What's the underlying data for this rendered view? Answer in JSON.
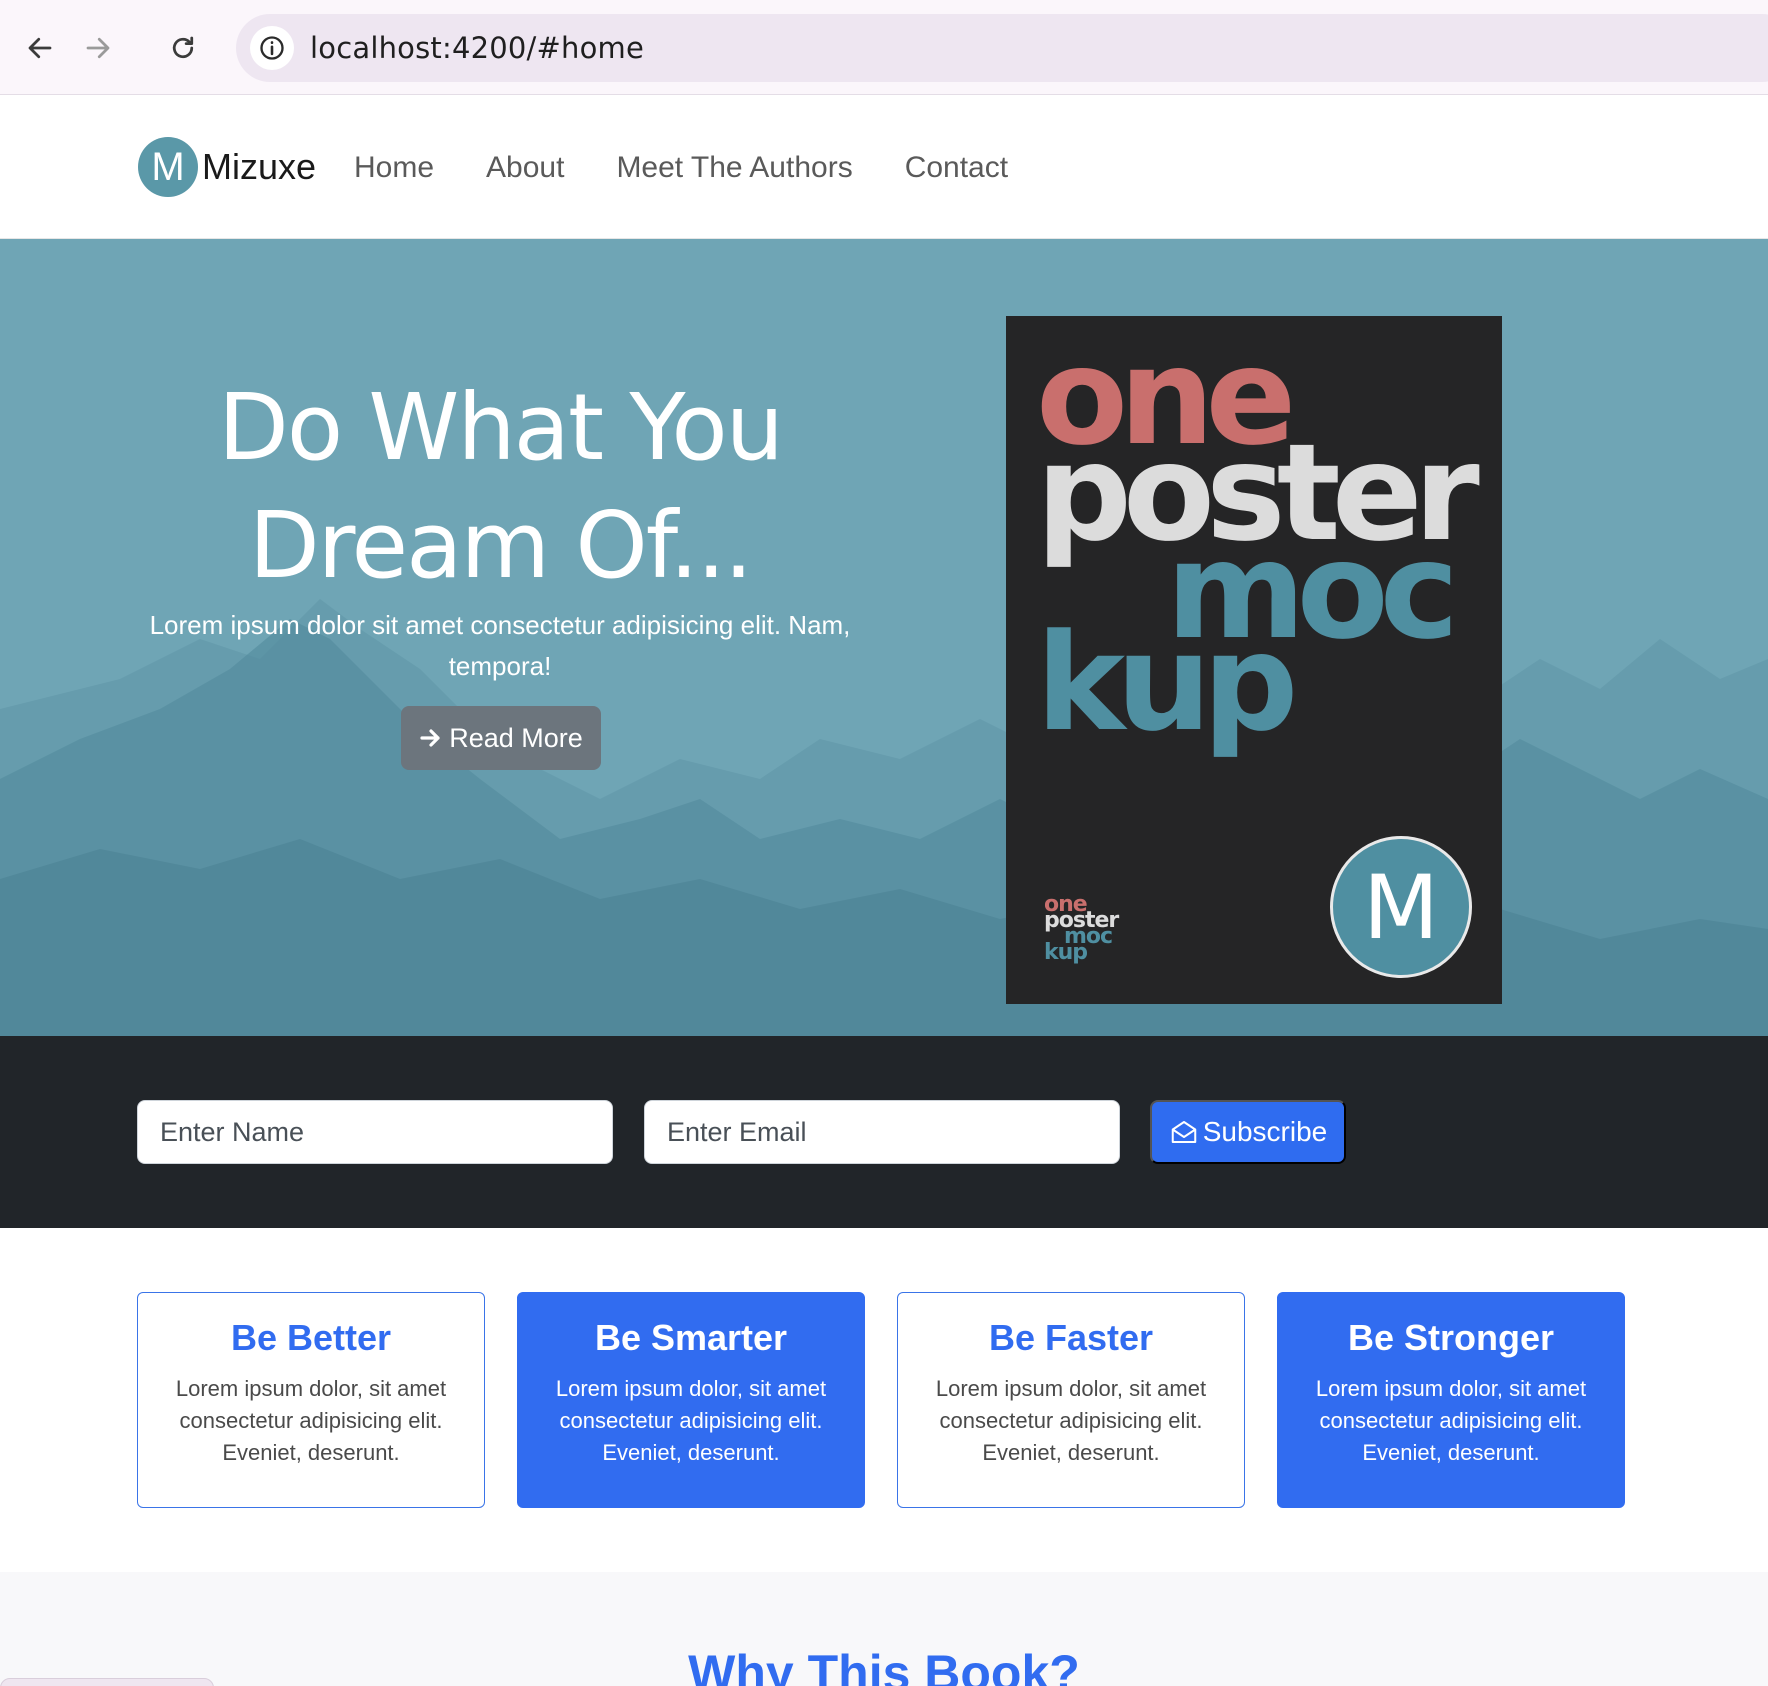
{
  "browser": {
    "url": "localhost:4200/#home",
    "icons": {
      "back": "arrow-left-icon",
      "forward": "arrow-right-icon",
      "reload": "reload-icon",
      "info": "info-icon"
    }
  },
  "navbar": {
    "brand_letter": "M",
    "brand_name": "Mizuxe",
    "links": [
      "Home",
      "About",
      "Meet The Authors",
      "Contact"
    ]
  },
  "hero": {
    "title_line1": "Do What You",
    "title_line2": "Dream Of...",
    "subtitle": "Lorem ipsum dolor sit amet consectetur adipisicing elit. Nam, tempora!",
    "read_more": "Read More",
    "poster": {
      "word1": "one",
      "word2": "poster",
      "word3": "moc",
      "word4": "kup",
      "logo_letter": "M"
    }
  },
  "subscribe": {
    "name_placeholder": "Enter Name",
    "email_placeholder": "Enter Email",
    "button": "Subscribe"
  },
  "cards": [
    {
      "title": "Be Better",
      "text": "Lorem ipsum dolor, sit amet consectetur adipisicing elit. Eveniet, deserunt."
    },
    {
      "title": "Be Smarter",
      "text": "Lorem ipsum dolor, sit amet consectetur adipisicing elit. Eveniet, deserunt."
    },
    {
      "title": "Be Faster",
      "text": "Lorem ipsum dolor, sit amet consectetur adipisicing elit. Eveniet, deserunt."
    },
    {
      "title": "Be Stronger",
      "text": "Lorem ipsum dolor, sit amet consectetur adipisicing elit. Eveniet, deserunt."
    }
  ],
  "why": {
    "title": "Why This Book?"
  },
  "colors": {
    "primary": "#316cf0",
    "hero_bg": "#6fa5b5",
    "dark_band": "#212529",
    "secondary_button": "#6c757d"
  }
}
